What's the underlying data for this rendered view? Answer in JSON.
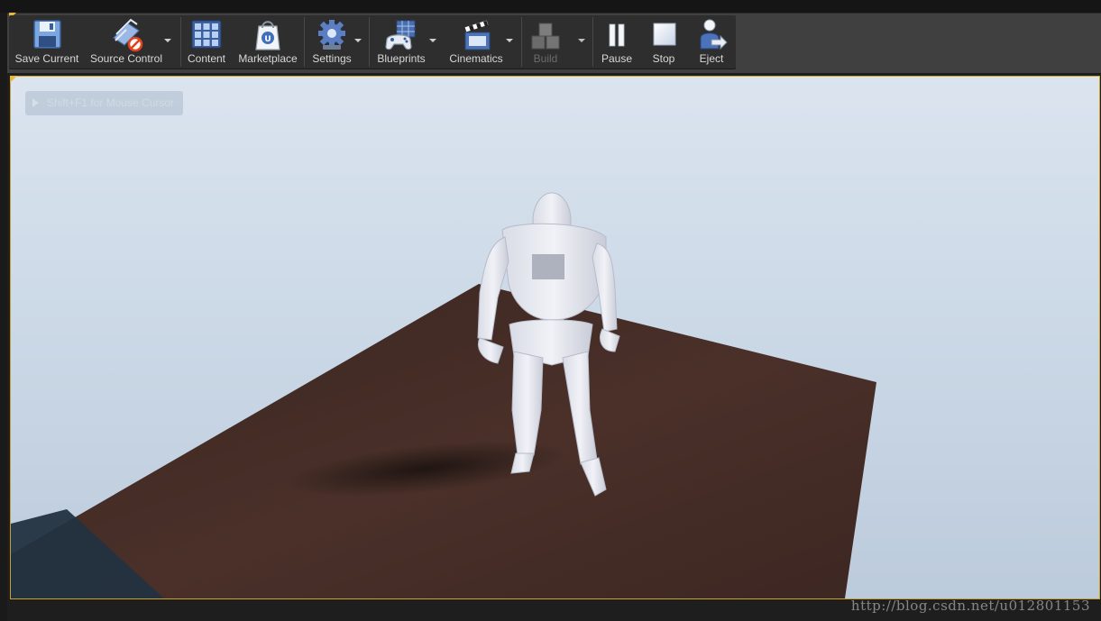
{
  "toolbar": {
    "save_current": "Save Current",
    "source_control": "Source Control",
    "content": "Content",
    "marketplace": "Marketplace",
    "settings": "Settings",
    "blueprints": "Blueprints",
    "cinematics": "Cinematics",
    "build": "Build",
    "pause": "Pause",
    "stop": "Stop",
    "eject": "Eject"
  },
  "viewport": {
    "overlay_text": "Shift+F1 for Mouse Cursor"
  },
  "watermark": "http://blog.csdn.net/u012801153",
  "colors": {
    "viewport_border": "#c9a227",
    "active_tab": "#e7b93a",
    "toolbar_bg": "#2e2e2e",
    "sky": "#d3dee9",
    "floor": "#3d2a24"
  }
}
